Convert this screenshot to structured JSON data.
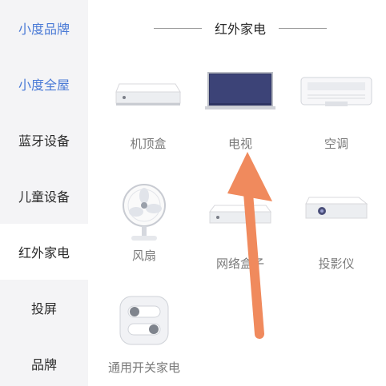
{
  "sidebar": {
    "items": [
      {
        "label": "小度品牌"
      },
      {
        "label": "小度全屋"
      },
      {
        "label": "蓝牙设备"
      },
      {
        "label": "儿童设备"
      },
      {
        "label": "红外家电"
      },
      {
        "label": "投屏"
      },
      {
        "label": "品牌"
      }
    ]
  },
  "main": {
    "section_title": "红外家电",
    "tiles": [
      {
        "label": "机顶盒",
        "icon": "set-top-box-icon"
      },
      {
        "label": "电视",
        "icon": "tv-icon"
      },
      {
        "label": "空调",
        "icon": "air-conditioner-icon"
      },
      {
        "label": "风扇",
        "icon": "fan-icon"
      },
      {
        "label": "网络盒子",
        "icon": "network-box-icon"
      },
      {
        "label": "投影仪",
        "icon": "projector-icon"
      },
      {
        "label": "通用开关家电",
        "icon": "switch-icon"
      }
    ]
  },
  "colors": {
    "sidebar_bg": "#f4f4f6",
    "accent_blue": "#4a7ad6",
    "arrow": "#f08a5d"
  }
}
